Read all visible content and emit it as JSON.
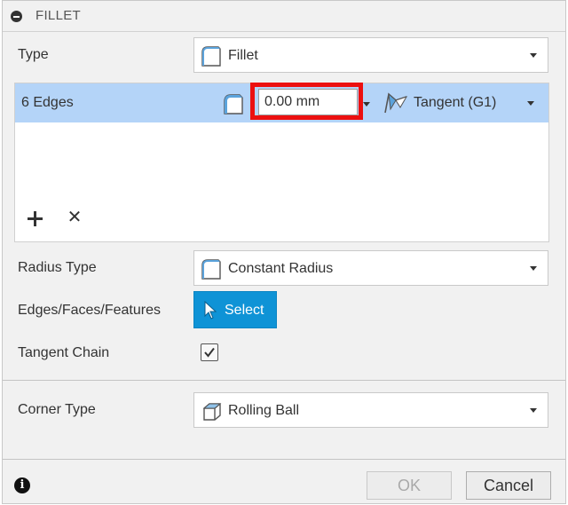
{
  "header": {
    "title": "FILLET"
  },
  "type_row": {
    "label": "Type",
    "value": "Fillet",
    "icon": "fillet-icon"
  },
  "edges": {
    "count_label": "6 Edges",
    "value": "0.00 mm",
    "continuity": "Tangent (G1)",
    "value_icon": "fillet-icon",
    "continuity_icon": "tangent-icon",
    "add_icon": "plus-icon",
    "remove_icon": "close-icon",
    "row_color": "#b4d4f8",
    "highlight_color": "#ec1010"
  },
  "radius_type": {
    "label": "Radius Type",
    "value": "Constant Radius",
    "icon": "fillet-icon"
  },
  "selection": {
    "label": "Edges/Faces/Features",
    "button_label": "Select",
    "icon": "cursor-icon",
    "button_color": "#0f93d6"
  },
  "tangent_chain": {
    "label": "Tangent Chain",
    "checked": true
  },
  "corner_type": {
    "label": "Corner Type",
    "value": "Rolling Ball",
    "icon": "rolling-ball-icon"
  },
  "footer": {
    "info_icon": "info-icon",
    "ok_label": "OK",
    "ok_disabled": true,
    "cancel_label": "Cancel"
  }
}
